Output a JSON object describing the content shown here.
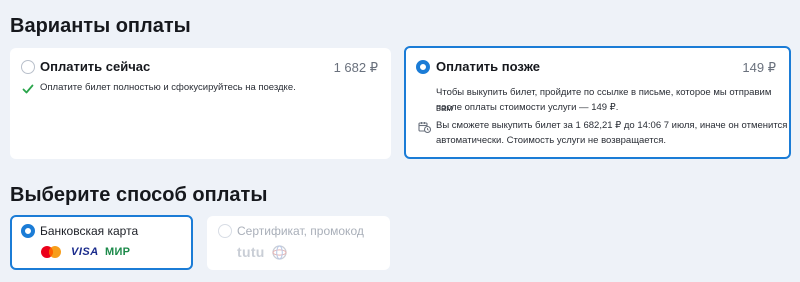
{
  "payment_options": {
    "heading": "Варианты оплаты",
    "now": {
      "title": "Оплатить сейчас",
      "price": "1 682 ₽",
      "note": "Оплатите билет полностью и сфокусируйтесь на поездке."
    },
    "later": {
      "title": "Оплатить позже",
      "price": "149 ₽",
      "desc_line1": "Чтобы выкупить билет, пройдите по ссылке в письме, которое мы отправим вам",
      "desc_line2": "после оплаты стоимости услуги — 149 ₽.",
      "info_line1": "Вы сможете выкупить билет за 1 682,21 ₽ до 14:06 7 июля, иначе он отменится",
      "info_line2": "автоматически. Стоимость услуги не возвращается."
    }
  },
  "payment_method": {
    "heading": "Выберите способ оплаты",
    "bank_card": {
      "label": "Банковская карта",
      "visa": "VISA",
      "mir": "МИР"
    },
    "certificate": {
      "label": "Сертификат, промокод",
      "brand": "tutu"
    }
  },
  "colors": {
    "accent": "#1b7cd6",
    "check": "#2aa54b",
    "background": "#eef2f8"
  }
}
